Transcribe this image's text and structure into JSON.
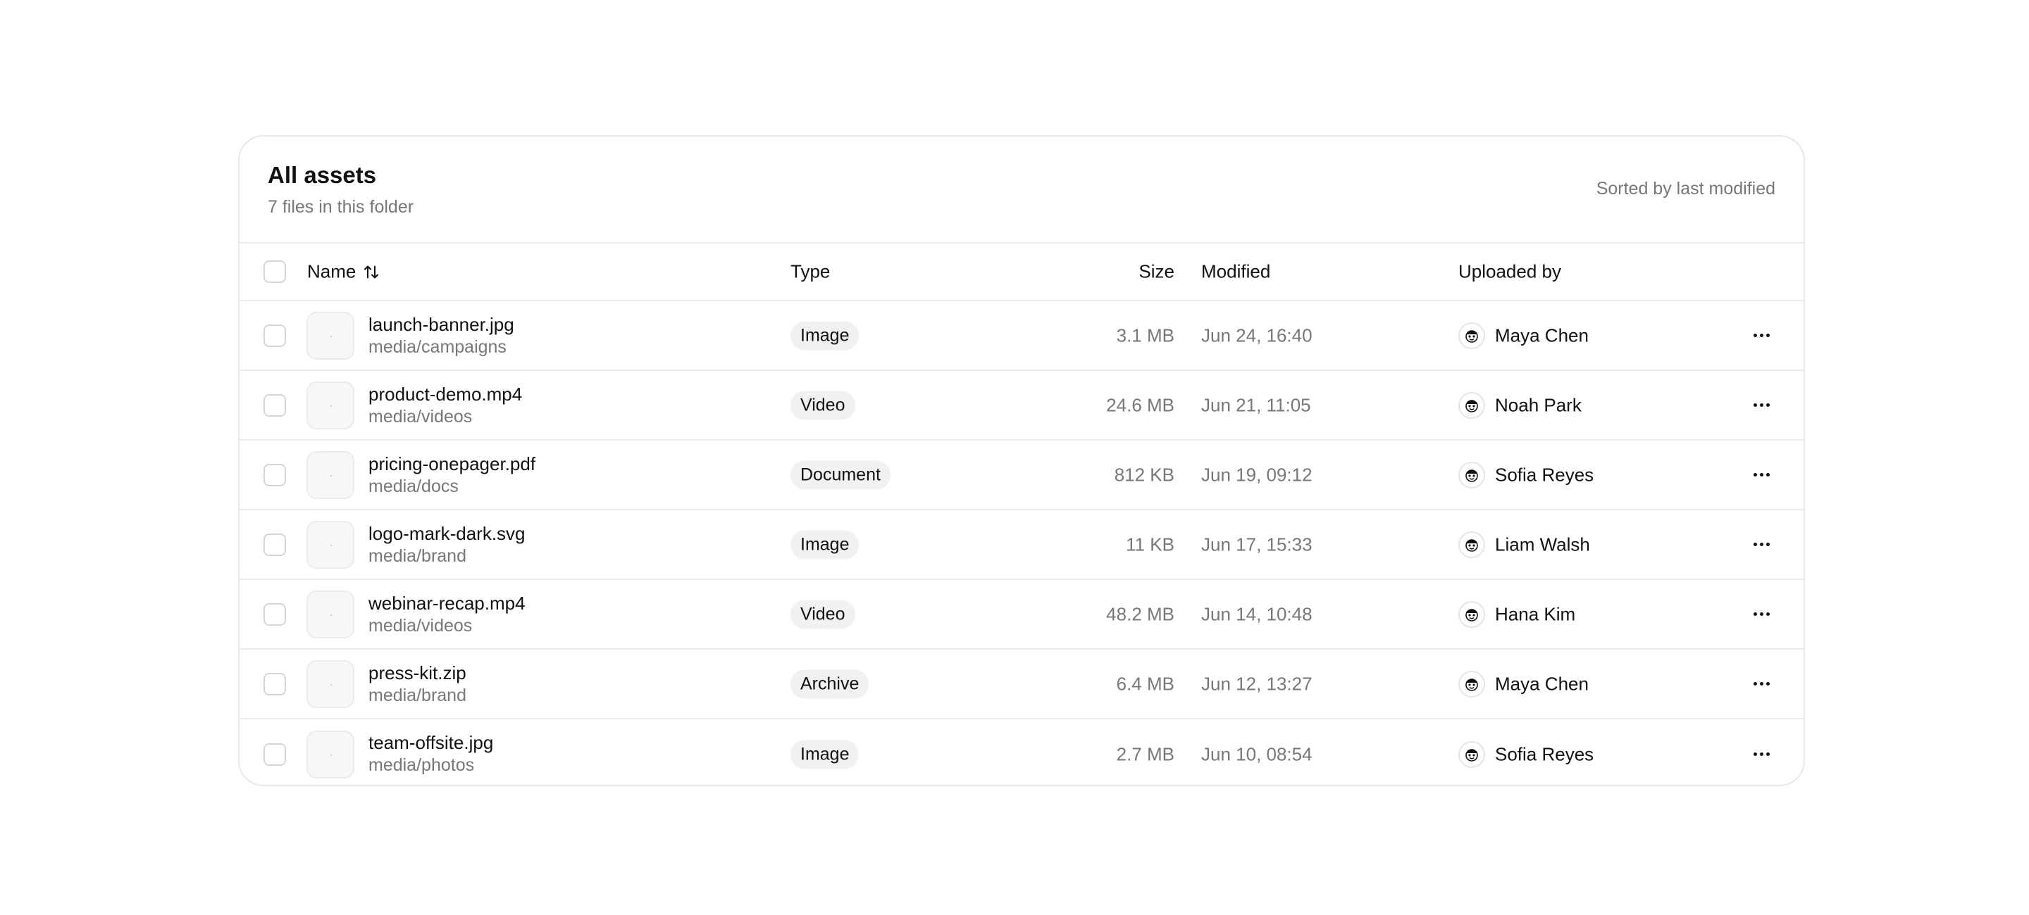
{
  "header": {
    "title": "All assets",
    "subtitle": "7 files in this folder",
    "sort_note": "Sorted by last modified"
  },
  "columns": {
    "name": "Name",
    "type": "Type",
    "size": "Size",
    "modified": "Modified",
    "uploaded_by": "Uploaded by"
  },
  "icons": {
    "sort": "sort-arrows-icon",
    "more": "more-horizontal-icon",
    "thumbnail": "file-thumbnail-icon",
    "avatar": "user-avatar-icon"
  },
  "rows": [
    {
      "name": "launch-banner.jpg",
      "path": "media/campaigns",
      "type": "Image",
      "size": "3.1 MB",
      "modified": "Jun 24, 16:40",
      "uploader": "Maya Chen"
    },
    {
      "name": "product-demo.mp4",
      "path": "media/videos",
      "type": "Video",
      "size": "24.6 MB",
      "modified": "Jun 21, 11:05",
      "uploader": "Noah Park"
    },
    {
      "name": "pricing-onepager.pdf",
      "path": "media/docs",
      "type": "Document",
      "size": "812 KB",
      "modified": "Jun 19, 09:12",
      "uploader": "Sofia Reyes"
    },
    {
      "name": "logo-mark-dark.svg",
      "path": "media/brand",
      "type": "Image",
      "size": "11 KB",
      "modified": "Jun 17, 15:33",
      "uploader": "Liam Walsh"
    },
    {
      "name": "webinar-recap.mp4",
      "path": "media/videos",
      "type": "Video",
      "size": "48.2 MB",
      "modified": "Jun 14, 10:48",
      "uploader": "Hana Kim"
    },
    {
      "name": "press-kit.zip",
      "path": "media/brand",
      "type": "Archive",
      "size": "6.4 MB",
      "modified": "Jun 12, 13:27",
      "uploader": "Maya Chen"
    },
    {
      "name": "team-offsite.jpg",
      "path": "media/photos",
      "type": "Image",
      "size": "2.7 MB",
      "modified": "Jun 10, 08:54",
      "uploader": "Sofia Reyes"
    }
  ]
}
